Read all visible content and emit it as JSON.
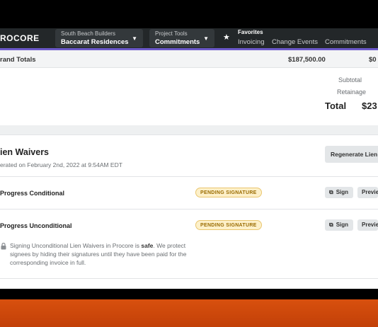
{
  "nav": {
    "logo": "ROCORE",
    "company": {
      "small": "South Beach Builders",
      "big": "Baccarat Residences"
    },
    "tools": {
      "small": "Project Tools",
      "big": "Commitments"
    },
    "favorites": {
      "title": "Favorites",
      "links": [
        "Invoicing",
        "Change Events",
        "Commitments"
      ]
    },
    "colors": {
      "bar": "#232729",
      "accent": "#6c59c9"
    }
  },
  "totals": {
    "row_label": "rand Totals",
    "amount1": "$187,500.00",
    "amount2": "$0",
    "subtotal_label": "Subtotal",
    "retainage_label": "Retainage",
    "total_label": "Total",
    "total_value": "$23"
  },
  "lien_waivers": {
    "title": "ien Waivers",
    "subtitle": "erated on February 2nd, 2022 at 9:54AM EDT",
    "regenerate_label": "Regenerate Lien",
    "rows": [
      {
        "name": "Progress Conditional",
        "status": "PENDING SIGNATURE",
        "sign": "Sign",
        "preview": "Previe"
      },
      {
        "name": "Progress Unconditional",
        "status": "PENDING SIGNATURE",
        "sign": "Sign",
        "preview": "Previe"
      }
    ],
    "note": {
      "before": "Signing Unconditional Lien Waivers in Procore is ",
      "bold": "safe",
      "after": ". We protect signees by hiding their signatures until they have been paid for the corresponding invoice in full."
    },
    "badge_colors": {
      "bg": "#fdf0c9",
      "text": "#9a6b00"
    }
  }
}
